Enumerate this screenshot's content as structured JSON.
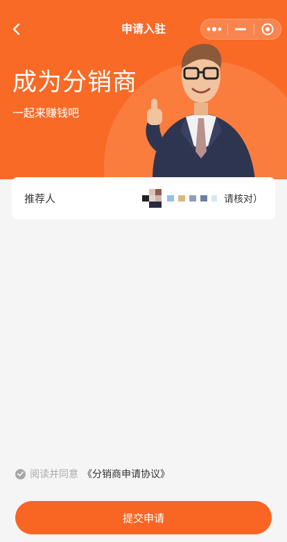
{
  "nav": {
    "title": "申请入驻",
    "back_icon": "chevron-left-icon",
    "more_icon": "more-dots-icon",
    "minimize_icon": "minimize-icon",
    "close_icon": "target-close-icon"
  },
  "hero": {
    "title": "成为分销商",
    "subtitle": "一起来赚钱吧",
    "background": "#f86a26"
  },
  "referrer": {
    "label": "推荐人",
    "note": "请核对）"
  },
  "agreement": {
    "prefix": "阅读并同意",
    "link": "《分销商申请协议》"
  },
  "submit": {
    "label": "提交申请",
    "color": "#f96624"
  }
}
